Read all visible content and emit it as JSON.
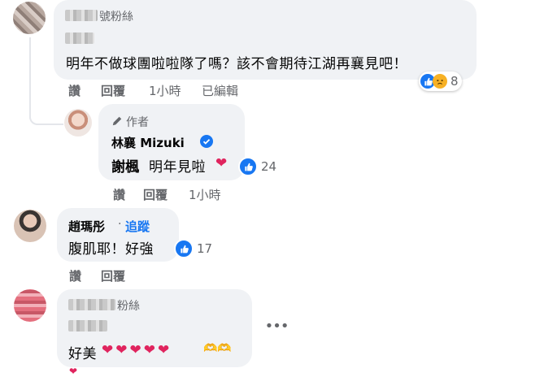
{
  "comments": [
    {
      "name_visible": "號粉絲",
      "text": "明年不做球團啦啦隊了嗎？該不會期待江湖再襄見吧！",
      "actions": {
        "like": "讚",
        "reply": "回覆",
        "time": "1小時",
        "edited": "已編輯"
      },
      "reaction_count": "8"
    },
    {
      "author_badge": "作者",
      "name": "林襄 Mizuki",
      "mention": "謝楓",
      "text": "明年見啦",
      "actions": {
        "like": "讚",
        "reply": "回覆",
        "time": "1小時"
      },
      "reaction_count": "24"
    },
    {
      "name": "趙瑪彤",
      "follow": "追蹤",
      "text": "腹肌耶！好強",
      "actions": {
        "like": "讚",
        "reply": "回覆"
      },
      "reaction_count": "17"
    },
    {
      "name_visible": "粉絲",
      "text": "好美",
      "hearts": "❤❤❤❤❤",
      "hands": "🫶🫶"
    }
  ],
  "more_icon": "ellipsis-icon",
  "colors": {
    "like_blue": "#1877f2",
    "heart_red": "#e0245e",
    "bubble": "#f0f2f5",
    "meta_gray": "#65676b"
  }
}
